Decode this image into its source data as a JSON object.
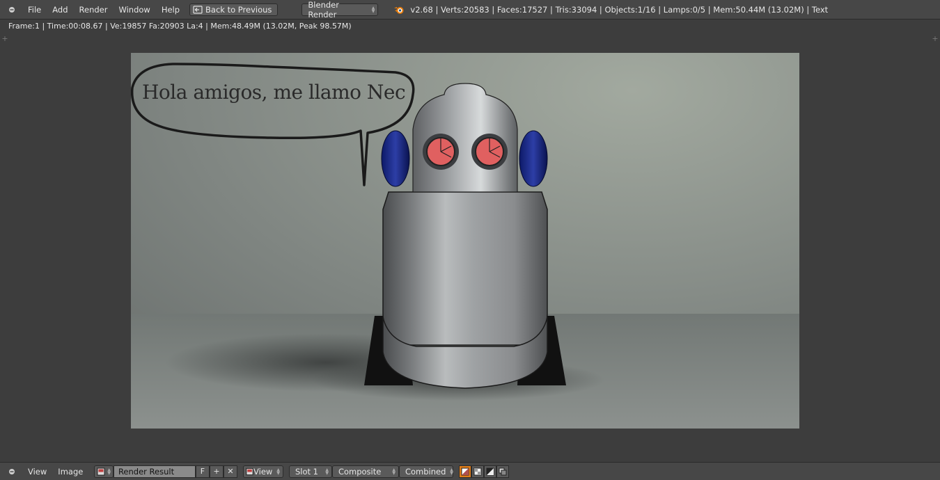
{
  "menu": {
    "file": "File",
    "add": "Add",
    "render": "Render",
    "window": "Window",
    "help": "Help"
  },
  "back_button": "Back to Previous",
  "engine": "Blender Render",
  "stats": "v2.68 | Verts:20583 | Faces:17527 | Tris:33094 | Objects:1/16 | Lamps:0/5 | Mem:50.44M (13.02M) | Text",
  "render_info": "Frame:1 | Time:00:08.67 | Ve:19857 Fa:20903 La:4 | Mem:48.49M (13.02M, Peak 98.57M)",
  "render_image": {
    "speech_text": "Hola amigos, me llamo Nec"
  },
  "bottom": {
    "view": "View",
    "image": "Image",
    "image_name": "Render Result",
    "fake_user": "F",
    "add": "+",
    "remove": "✕",
    "view_dropdown": "View",
    "slot": "Slot 1",
    "layer": "Composite",
    "pass": "Combined"
  },
  "colors": {
    "header_bg": "#474747",
    "area_bg": "#3d3d3d",
    "active_orange": "#e07c18"
  },
  "icons": [
    "area-toggle-icon",
    "back-arrow-icon",
    "blender-logo-icon",
    "image-browse-icon",
    "alpha-checker-icon",
    "draw-mode-icons"
  ]
}
